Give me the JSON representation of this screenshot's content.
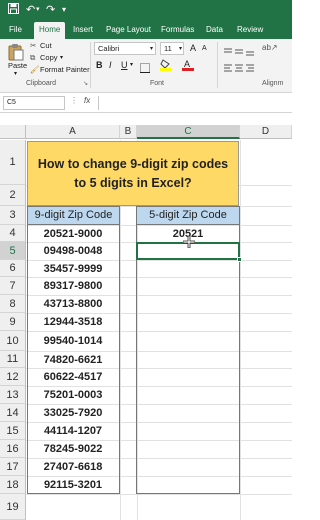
{
  "colors": {
    "ribbon_green": "#217346",
    "title_fill": "#ffd966",
    "header_fill": "#bdd7ee"
  },
  "titlebar": {
    "save_icon": "save-icon",
    "undo_icon": "undo-icon",
    "redo_icon": "redo-icon",
    "qat_icon": "quick-access-icon"
  },
  "tabs": [
    "File",
    "Home",
    "Insert",
    "Page Layout",
    "Formulas",
    "Data",
    "Review"
  ],
  "ribbon": {
    "paste_label": "Paste",
    "cut_label": "Cut",
    "copy_label": "Copy",
    "format_painter_label": "Format Painter",
    "clipboard_group": "Clipboard",
    "font_name": "Calibri",
    "font_size": "11",
    "font_group": "Font",
    "bold": "B",
    "italic": "I",
    "underline": "U",
    "grow_font": "A",
    "shrink_font": "A",
    "alignment_group": "Alignm"
  },
  "formula_bar": {
    "name_box": "C5",
    "fx": "fx",
    "formula": ""
  },
  "columns": [
    "A",
    "B",
    "C",
    "D"
  ],
  "rows": [
    "1",
    "2",
    "3",
    "4",
    "5",
    "6",
    "7",
    "8",
    "9",
    "10",
    "11",
    "12",
    "13",
    "14",
    "15",
    "16",
    "17",
    "18",
    "19"
  ],
  "sheet": {
    "title": "How to change 9-digit zip codes to 5 digits in Excel?",
    "col_a_header": "9-digit Zip Code",
    "col_c_header": "5-digit Zip Code",
    "col_a_values": [
      "20521-9000",
      "09498-0048",
      "35457-9999",
      "89317-9800",
      "43713-8800",
      "12944-3518",
      "99540-1014",
      "74820-6621",
      "60622-4517",
      "75201-0003",
      "33025-7920",
      "44114-1207",
      "78245-9022",
      "27407-6618",
      "92115-3201"
    ],
    "col_c_values": [
      "20521",
      "",
      "",
      "",
      "",
      "",
      "",
      "",
      "",
      "",
      "",
      "",
      "",
      "",
      ""
    ]
  }
}
